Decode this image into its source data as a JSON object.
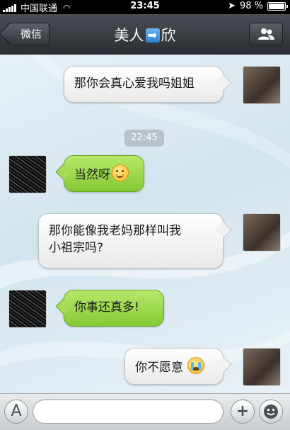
{
  "status_bar": {
    "carrier": "中国联通",
    "time": "23:45",
    "battery": "98 %",
    "battery_level": 0.98
  },
  "nav": {
    "back_label": "微信",
    "title_left": "美人",
    "title_right": "欣",
    "title_icon": "arrow-right-icon",
    "right_icon": "group-icon"
  },
  "chat": {
    "timestamp": "22:45",
    "messages": [
      {
        "from": "me",
        "text": "那你会真心爱我吗姐姐"
      },
      {
        "from": "other",
        "text": "当然呀",
        "emoji": "smile-icon"
      },
      {
        "from": "me",
        "lines": [
          "那你能像我老妈那样叫我",
          "小祖宗吗?"
        ]
      },
      {
        "from": "other",
        "text": "你事还真多!"
      },
      {
        "from": "me",
        "text": "你不愿意",
        "emoji": "cry-icon"
      }
    ]
  },
  "input_bar": {
    "voice_label": "A",
    "input_value": "",
    "add_label": "+",
    "emoji_icon": "emoji-icon"
  },
  "colors": {
    "incoming_bubble": "#9ed84e",
    "outgoing_bubble": "#f5f5f5",
    "nav_bar": "#3a3f44"
  }
}
